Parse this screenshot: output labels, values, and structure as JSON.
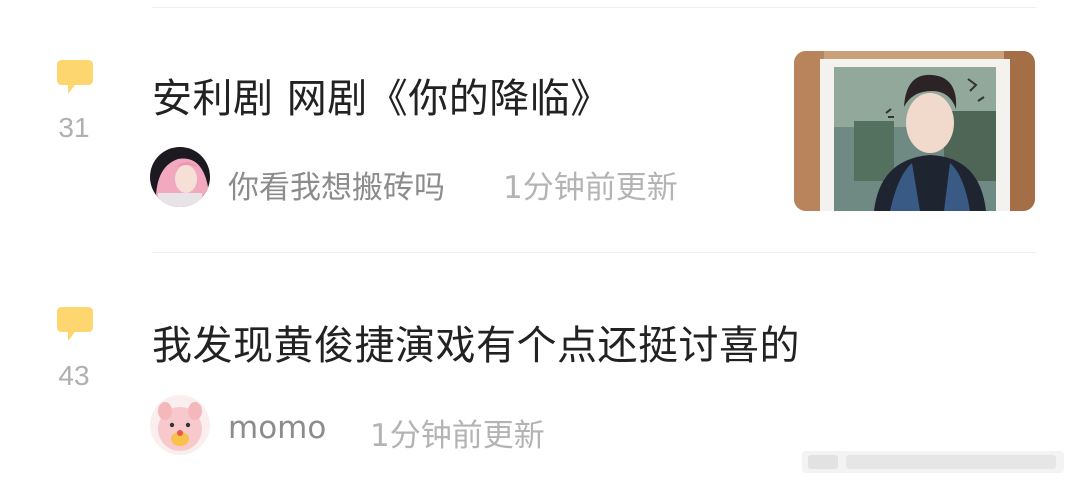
{
  "posts": [
    {
      "comment_count": "31",
      "title": "安利剧 网剧《你的降临》",
      "author": "你看我想搬砖吗",
      "time": "1分钟前更新",
      "has_thumbnail": true
    },
    {
      "comment_count": "43",
      "title": "我发现黄俊捷演戏有个点还挺讨喜的",
      "author": "momo",
      "time": "1分钟前更新",
      "has_thumbnail": false
    }
  ],
  "colors": {
    "comment_icon": "#fdd66f",
    "title_text": "#222222",
    "meta_text": "#8c8c8c",
    "divider": "#efefef"
  },
  "icons": {
    "comment": "comment-bubble-icon"
  }
}
